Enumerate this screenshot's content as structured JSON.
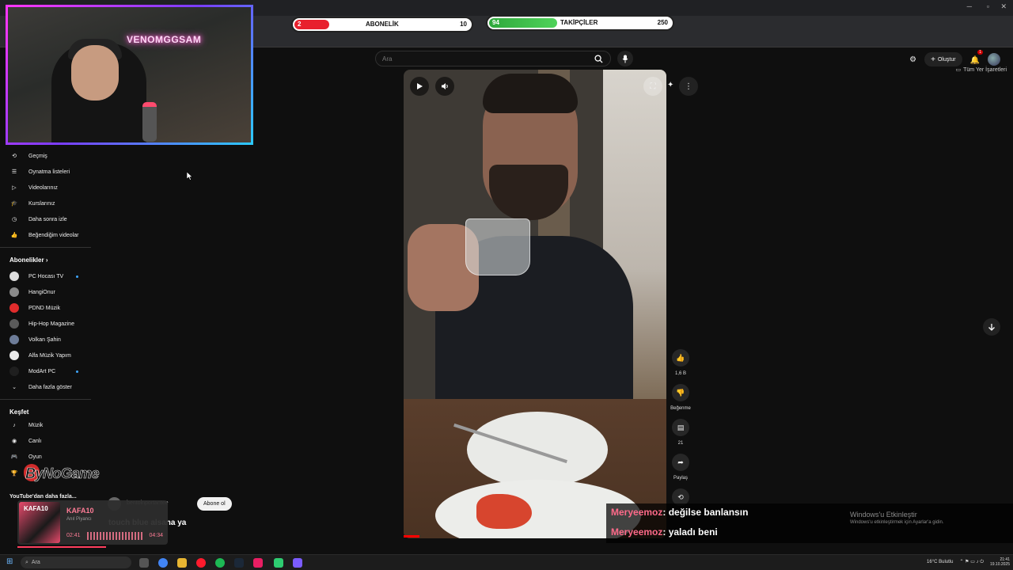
{
  "stream_overlay": {
    "subscriber_bar": {
      "label": "ABONELİK",
      "current": "2",
      "goal": "10",
      "progress": 0.2,
      "color": "#e8202d"
    },
    "follower_bar": {
      "label": "TAKİPÇİLER",
      "current": "94",
      "goal": "250",
      "progress": 0.376,
      "color": "#4fd35a"
    },
    "webcam_neon_text": "VENOMGGSAM",
    "brand_logo": "ByNoGame"
  },
  "browser": {
    "bookmarks_folder": "Tüm Yer İşaretleri"
  },
  "youtube": {
    "search": {
      "placeholder": "Ara",
      "value": ""
    },
    "create_label": "Oluştur",
    "notification_count": "1",
    "sidebar": {
      "you_items": [
        {
          "label": "Geçmiş",
          "icon": "history-icon"
        },
        {
          "label": "Oynatma listeleri",
          "icon": "playlist-icon"
        },
        {
          "label": "Videolarınız",
          "icon": "video-icon"
        },
        {
          "label": "Kurslarınız",
          "icon": "courses-icon"
        },
        {
          "label": "Daha sonra izle",
          "icon": "clock-icon"
        },
        {
          "label": "Beğendiğim videolar",
          "icon": "thumb-up-icon"
        }
      ],
      "subscriptions_heading": "Abonelikler",
      "subscriptions": [
        {
          "label": "PC Hocası TV",
          "live": true,
          "color": "#dcdcdc"
        },
        {
          "label": "HangiOnur",
          "live": false,
          "color": "#8a8a8a"
        },
        {
          "label": "PDND Müzik",
          "live": false,
          "color": "#e02c2c"
        },
        {
          "label": "Hip-Hop Magazine",
          "live": false,
          "color": "#5a5a5a"
        },
        {
          "label": "Volkan Şahin",
          "live": false,
          "color": "#6d7c98"
        },
        {
          "label": "Alfa Müzik Yapım",
          "live": false,
          "color": "#e8e8e8"
        },
        {
          "label": "ModArt PC",
          "live": true,
          "color": "#1f1f1f"
        }
      ],
      "show_more": "Daha fazla göster",
      "explore_heading": "Keşfet",
      "explore_items": [
        {
          "label": "Müzik",
          "icon": "music-note-icon"
        },
        {
          "label": "Canlı",
          "icon": "live-icon"
        },
        {
          "label": "Oyun",
          "icon": "gamepad-icon"
        }
      ],
      "more_from_youtube": "YouTube'dan daha fazla..."
    },
    "short": {
      "likes": "1,6 B",
      "dislike_label": "Beğenme",
      "comments": "21",
      "share_label": "Paylaş",
      "channel": "bentoinportantee",
      "subscribe_label": "Abone ol",
      "caption": "touch blue alsana ya"
    }
  },
  "chat": [
    {
      "user": "Meryeemoz",
      "message": ": değilse banlansın"
    },
    {
      "user": "Meryeemoz",
      "message": ": yaladı beni"
    }
  ],
  "windows_activation": {
    "title": "Windows'u Etkinleştir",
    "subtitle": "Windows'u etkinleştirmek için Ayarlar'a gidin."
  },
  "music_widget": {
    "album_text": "KAFA10",
    "title": "KAFA10",
    "artist": "Anıl Piyancı",
    "elapsed": "02:41",
    "duration": "04:34",
    "progress": 0.59
  },
  "taskbar": {
    "search_placeholder": "Ara",
    "weather": "16°C  Bulutlu",
    "time": "21:41",
    "date": "19.10.2025"
  }
}
